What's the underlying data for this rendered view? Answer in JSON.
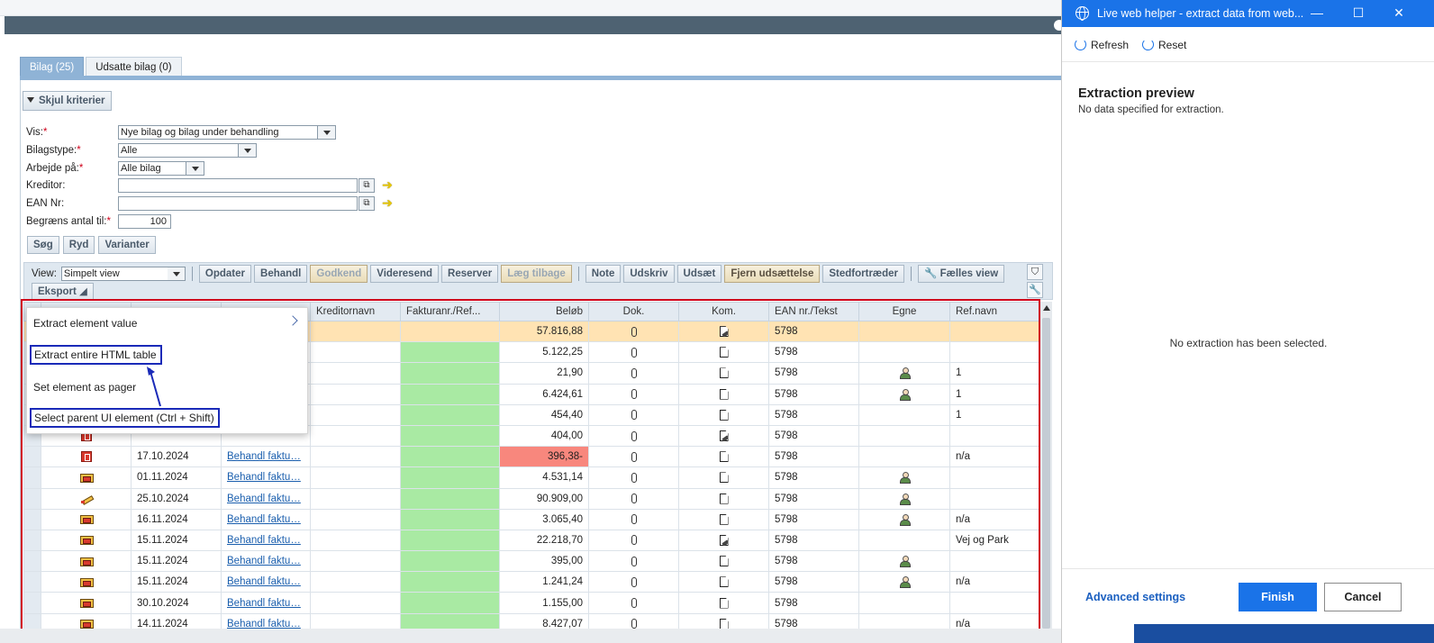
{
  "app": {
    "tabs": [
      {
        "label": "Bilag (25)",
        "active": true
      },
      {
        "label": "Udsatte bilag (0)",
        "active": false
      }
    ],
    "criteria_toggle": "Skjul kriterier",
    "filters": {
      "vis": {
        "label": "Vis:",
        "value": "Nye bilag og bilag under behandling"
      },
      "bilagstype": {
        "label": "Bilagstype:",
        "value": "Alle"
      },
      "arbejde": {
        "label": "Arbejde på:",
        "value": "Alle bilag"
      },
      "kreditor": {
        "label": "Kreditor:",
        "value": ""
      },
      "ean": {
        "label": "EAN Nr:",
        "value": ""
      },
      "begraens": {
        "label": "Begræns antal til:",
        "value": "100"
      },
      "required_mark": "*"
    },
    "search_buttons": [
      "Søg",
      "Ryd",
      "Varianter"
    ],
    "toolbar": {
      "view_label": "View:",
      "view_value": "Simpelt view",
      "buttons": [
        "Opdater",
        "Behandl",
        "Godkend",
        "Videresend",
        "Reserver",
        "Læg tilbage",
        "Note",
        "Udskriv",
        "Udsæt",
        "Fjern udsættelse",
        "Stedfortræder",
        "Fælles view"
      ],
      "export": "Eksport"
    },
    "grid": {
      "headers": {
        "kreditornavn": "Kreditornavn",
        "fakturanr": "Fakturanr./Ref...",
        "belob": "Beløb",
        "dok": "Dok.",
        "kom": "Kom.",
        "ean": "EAN nr./Tekst",
        "egne": "Egne",
        "refnavn": "Ref.navn"
      },
      "rows": [
        {
          "status": "",
          "date": "",
          "link": "",
          "amount": "57.816,88",
          "kom": "doc-pen",
          "ean": "5798",
          "egne": false,
          "ref": "",
          "neg": false,
          "hl": true
        },
        {
          "status": "",
          "date": "",
          "link": "",
          "amount": "5.122,25",
          "kom": "doc",
          "ean": "5798",
          "egne": false,
          "ref": "",
          "neg": false,
          "hl": false
        },
        {
          "status": "",
          "date": "",
          "link": "",
          "amount": "21,90",
          "kom": "doc",
          "ean": "5798",
          "egne": true,
          "ref": "1",
          "neg": false,
          "hl": false
        },
        {
          "status": "",
          "date": "",
          "link": "",
          "amount": "6.424,61",
          "kom": "doc",
          "ean": "5798",
          "egne": true,
          "ref": "1",
          "neg": false,
          "hl": false
        },
        {
          "status": "",
          "date": "",
          "link": "",
          "amount": "454,40",
          "kom": "doc",
          "ean": "5798",
          "egne": false,
          "ref": "1",
          "neg": false,
          "hl": false
        },
        {
          "status": "red",
          "date": "",
          "link": "",
          "amount": "404,00",
          "kom": "doc-pen",
          "ean": "5798",
          "egne": false,
          "ref": "",
          "neg": false,
          "hl": false
        },
        {
          "status": "red",
          "date": "17.10.2024",
          "link": "Behandl faktu…",
          "amount": "396,38-",
          "kom": "doc",
          "ean": "5798",
          "egne": false,
          "ref": "n/a",
          "neg": true,
          "hl": false
        },
        {
          "status": "pc",
          "date": "01.11.2024",
          "link": "Behandl faktu…",
          "amount": "4.531,14",
          "kom": "doc",
          "ean": "5798",
          "egne": true,
          "ref": "",
          "neg": false,
          "hl": false
        },
        {
          "status": "pen",
          "date": "25.10.2024",
          "link": "Behandl faktu…",
          "amount": "90.909,00",
          "kom": "doc",
          "ean": "5798",
          "egne": true,
          "ref": "",
          "neg": false,
          "hl": false
        },
        {
          "status": "pc",
          "date": "16.11.2024",
          "link": "Behandl faktu…",
          "amount": "3.065,40",
          "kom": "doc",
          "ean": "5798",
          "egne": true,
          "ref": "n/a",
          "neg": false,
          "hl": false
        },
        {
          "status": "pc",
          "date": "15.11.2024",
          "link": "Behandl faktu…",
          "amount": "22.218,70",
          "kom": "doc-pen",
          "ean": "5798",
          "egne": false,
          "ref": "Vej og Park",
          "neg": false,
          "hl": false
        },
        {
          "status": "pc",
          "date": "15.11.2024",
          "link": "Behandl faktu…",
          "amount": "395,00",
          "kom": "doc",
          "ean": "5798",
          "egne": true,
          "ref": "",
          "neg": false,
          "hl": false
        },
        {
          "status": "pc",
          "date": "15.11.2024",
          "link": "Behandl faktu…",
          "amount": "1.241,24",
          "kom": "doc",
          "ean": "5798",
          "egne": true,
          "ref": "n/a",
          "neg": false,
          "hl": false
        },
        {
          "status": "pc",
          "date": "30.10.2024",
          "link": "Behandl faktu…",
          "amount": "1.155,00",
          "kom": "doc",
          "ean": "5798",
          "egne": false,
          "ref": "",
          "neg": false,
          "hl": false
        },
        {
          "status": "pc",
          "date": "14.11.2024",
          "link": "Behandl faktu…",
          "amount": "8.427,07",
          "kom": "doc",
          "ean": "5798",
          "egne": false,
          "ref": "n/a",
          "neg": false,
          "hl": false
        }
      ]
    },
    "context_menu": {
      "items": [
        "Extract element value",
        "Extract entire HTML table",
        "Set element as pager",
        "Select parent UI element  (Ctrl + Shift)"
      ]
    }
  },
  "helper": {
    "title": "Live web helper - extract data from web...",
    "refresh": "Refresh",
    "reset": "Reset",
    "heading": "Extraction preview",
    "subheading": "No data specified for extraction.",
    "empty_message": "No extraction has been selected.",
    "advanced": "Advanced settings",
    "finish": "Finish",
    "cancel": "Cancel"
  },
  "colors": {
    "accent": "#1a73e8",
    "highlight_frame": "#d0021b",
    "menu_box": "#1a2ab8",
    "green_cell": "#a9eaa3",
    "negative_cell": "#f8877d",
    "selected_row": "#ffe3b3"
  }
}
